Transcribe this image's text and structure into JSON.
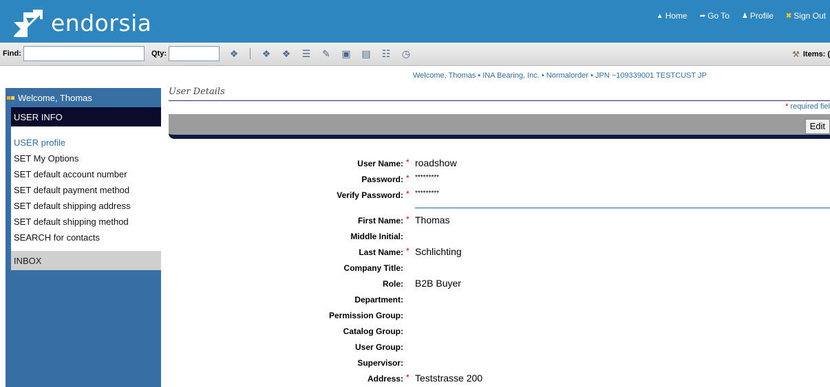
{
  "header": {
    "brand": "endorsia",
    "nav": [
      {
        "icon": "home-icon",
        "label": "Home"
      },
      {
        "icon": "goto-icon",
        "label": "Go To"
      },
      {
        "icon": "profile-icon",
        "label": "Profile"
      },
      {
        "icon": "signout-icon",
        "label": "Sign Out"
      }
    ]
  },
  "toolbar": {
    "find_label": "Find:",
    "find_value": "",
    "qty_label": "Qty:",
    "qty_value": "",
    "items_label": "Items: ("
  },
  "welcome_line": "Welcome,  Thomas  • INA Bearing, Inc.  • Normalorder  • JPN ~109339001  TESTCUST JP",
  "sidebar": {
    "welcome": "Welcome, Thomas",
    "section_title": "USER INFO",
    "items": [
      "USER profile",
      "SET My Options",
      "SET default account number",
      "SET default payment method",
      "SET default shipping address",
      "SET default shipping method",
      "SEARCH for contacts"
    ],
    "inbox": "INBOX"
  },
  "main": {
    "title": "User Details",
    "required_note": "required fiel",
    "edit_label": "Edit",
    "fields_account": [
      {
        "label": "User Name:",
        "required": true,
        "value": "roadshow"
      },
      {
        "label": "Password:",
        "required": true,
        "value": "*********"
      },
      {
        "label": "Verify Password:",
        "required": true,
        "value": "*********"
      }
    ],
    "fields_personal": [
      {
        "label": "First Name:",
        "required": true,
        "value": "Thomas"
      },
      {
        "label": "Middle Initial:",
        "required": false,
        "value": ""
      },
      {
        "label": "Last Name:",
        "required": true,
        "value": "Schlichting"
      },
      {
        "label": "Company Title:",
        "required": false,
        "value": ""
      },
      {
        "label": "Role:",
        "required": false,
        "value": "B2B Buyer"
      },
      {
        "label": "Department:",
        "required": false,
        "value": ""
      },
      {
        "label": "Permission Group:",
        "required": false,
        "value": ""
      },
      {
        "label": "Catalog Group:",
        "required": false,
        "value": ""
      },
      {
        "label": "User Group:",
        "required": false,
        "value": ""
      },
      {
        "label": "Supervisor:",
        "required": false,
        "value": ""
      },
      {
        "label": "Address:",
        "required": true,
        "value": "Teststrasse 200"
      }
    ]
  },
  "colors": {
    "header_bg": "#2e86c1",
    "sidebar_bg": "#376ea3",
    "link_blue": "#2e6fb0",
    "required_red": "#dd0000"
  }
}
